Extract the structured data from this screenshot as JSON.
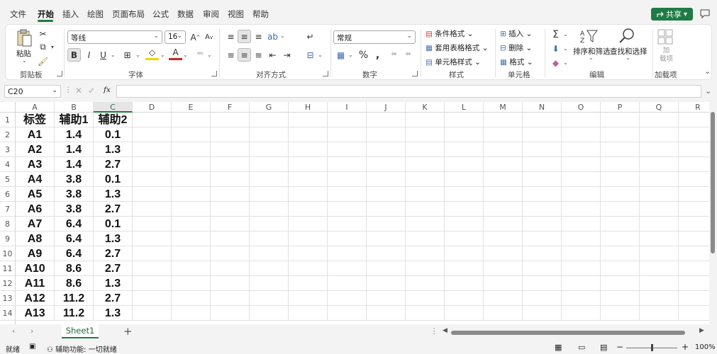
{
  "menu": {
    "tabs": [
      "文件",
      "开始",
      "插入",
      "绘图",
      "页面布局",
      "公式",
      "数据",
      "审阅",
      "视图",
      "帮助"
    ],
    "active_tab": "开始",
    "share_label": "共享"
  },
  "ribbon": {
    "clipboard": {
      "paste": "粘贴",
      "label": "剪贴板"
    },
    "font": {
      "name": "等线",
      "size": "16",
      "bold": "B",
      "italic": "I",
      "underline": "U",
      "label": "字体"
    },
    "alignment": {
      "label": "对齐方式"
    },
    "number": {
      "format": "常规",
      "label": "数字"
    },
    "styles": {
      "conditional": "条件格式",
      "table": "套用表格格式",
      "cell": "单元格样式",
      "label": "样式"
    },
    "cells": {
      "insert": "插入",
      "delete": "删除",
      "format": "格式",
      "label": "单元格"
    },
    "editing": {
      "sort": "排序和筛选",
      "find": "查找和选择",
      "label": "编辑"
    },
    "addins": {
      "button": "加\n载项",
      "label": "加载项"
    }
  },
  "formula_bar": {
    "name_box": "C20",
    "fx": "fx",
    "value": ""
  },
  "grid": {
    "columns": [
      "A",
      "B",
      "C",
      "D",
      "E",
      "F",
      "G",
      "H",
      "I",
      "J",
      "K",
      "L",
      "M",
      "N",
      "O",
      "P",
      "Q",
      "R"
    ],
    "selected_column": "C",
    "rows": [
      [
        "标签",
        "辅助1",
        "辅助2"
      ],
      [
        "A1",
        "1.4",
        "0.1"
      ],
      [
        "A2",
        "1.4",
        "1.3"
      ],
      [
        "A3",
        "1.4",
        "2.7"
      ],
      [
        "A4",
        "3.8",
        "0.1"
      ],
      [
        "A5",
        "3.8",
        "1.3"
      ],
      [
        "A6",
        "3.8",
        "2.7"
      ],
      [
        "A7",
        "6.4",
        "0.1"
      ],
      [
        "A8",
        "6.4",
        "1.3"
      ],
      [
        "A9",
        "6.4",
        "2.7"
      ],
      [
        "A10",
        "8.6",
        "2.7"
      ],
      [
        "A11",
        "8.6",
        "1.3"
      ],
      [
        "A12",
        "11.2",
        "2.7"
      ],
      [
        "A13",
        "11.2",
        "1.3"
      ]
    ]
  },
  "sheets": {
    "tabs": [
      "Sheet1"
    ],
    "add": "+"
  },
  "status": {
    "ready": "就绪",
    "accessibility": "辅助功能: 一切就绪",
    "zoom": "100%"
  }
}
